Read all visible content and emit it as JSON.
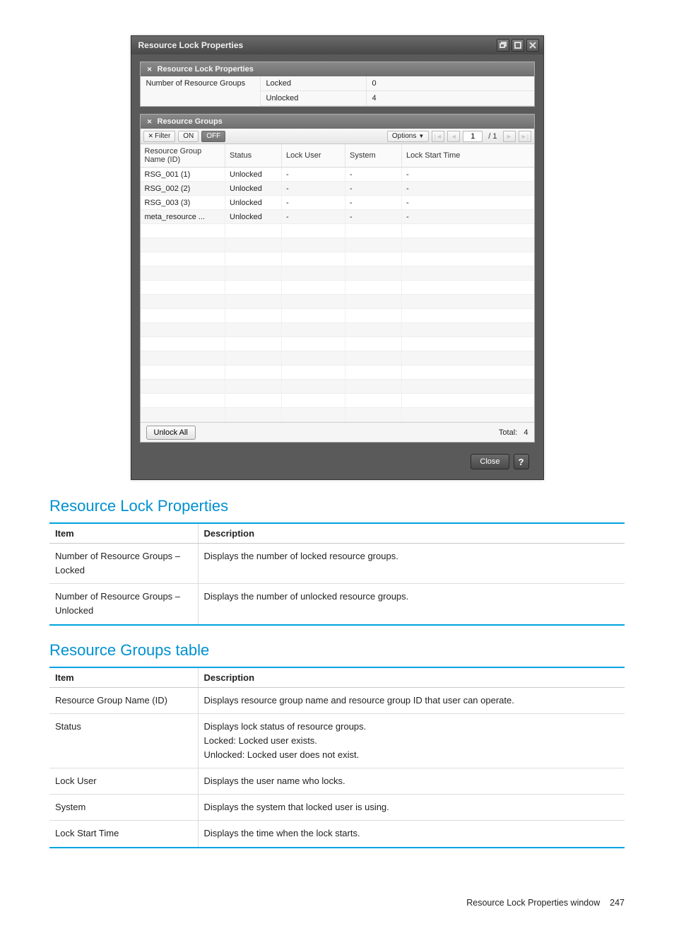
{
  "window": {
    "title": "Resource Lock Properties"
  },
  "panel1": {
    "title": "Resource Lock Properties",
    "row_label": "Number of Resource Groups",
    "locked_label": "Locked",
    "locked_value": "0",
    "unlocked_label": "Unlocked",
    "unlocked_value": "4"
  },
  "panel2": {
    "title": "Resource Groups",
    "toolbar": {
      "filter_label": "Filter",
      "on_label": "ON",
      "off_label": "OFF",
      "options_label": "Options",
      "page_current": "1",
      "page_sep": "/",
      "page_total": "1"
    },
    "columns": {
      "c0": "Resource Group Name (ID)",
      "c1": "Status",
      "c2": "Lock User",
      "c3": "System",
      "c4": "Lock Start Time"
    },
    "rows": [
      {
        "c0": "RSG_001 (1)",
        "c1": "Unlocked",
        "c2": "-",
        "c3": "-",
        "c4": "-"
      },
      {
        "c0": "RSG_002 (2)",
        "c1": "Unlocked",
        "c2": "-",
        "c3": "-",
        "c4": "-"
      },
      {
        "c0": "RSG_003 (3)",
        "c1": "Unlocked",
        "c2": "-",
        "c3": "-",
        "c4": "-"
      },
      {
        "c0": "meta_resource ...",
        "c1": "Unlocked",
        "c2": "-",
        "c3": "-",
        "c4": "-"
      }
    ],
    "empty_row_count": 14,
    "footer": {
      "unlock_all": "Unlock All",
      "total_label": "Total:",
      "total_value": "4"
    }
  },
  "dialog_buttons": {
    "close": "Close",
    "help": "?"
  },
  "doc": {
    "h1": "Resource Lock Properties",
    "table1": {
      "hdr_item": "Item",
      "hdr_desc": "Description",
      "rows": [
        {
          "item": "Number of Resource Groups – Locked",
          "desc": "Displays the number of locked resource groups."
        },
        {
          "item": "Number of Resource Groups – Unlocked",
          "desc": "Displays the number of unlocked resource groups."
        }
      ]
    },
    "h2": "Resource Groups table",
    "table2": {
      "hdr_item": "Item",
      "hdr_desc": "Description",
      "rows": [
        {
          "item": "Resource Group Name (ID)",
          "desc": "Displays resource group name and resource group ID that user can operate."
        },
        {
          "item": "Status",
          "desc": "Displays lock status of resource groups.\nLocked: Locked user exists.\nUnlocked: Locked user does not exist."
        },
        {
          "item": "Lock User",
          "desc": "Displays the user name who locks."
        },
        {
          "item": "System",
          "desc": "Displays the system that locked user is using."
        },
        {
          "item": "Lock Start Time",
          "desc": "Displays the time when the lock starts."
        }
      ]
    },
    "footer_text": "Resource Lock Properties window",
    "page_number": "247"
  }
}
